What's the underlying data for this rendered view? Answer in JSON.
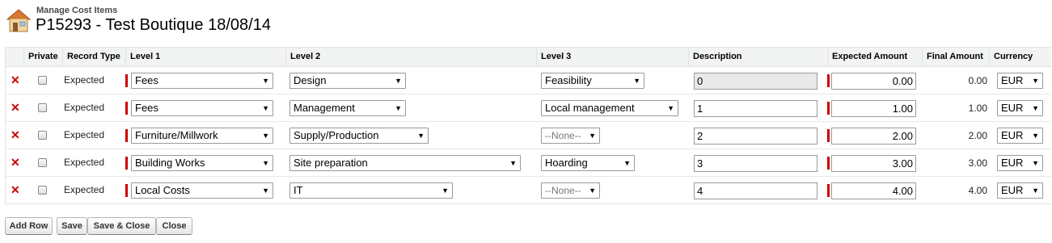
{
  "header": {
    "subtitle": "Manage Cost Items",
    "title": "P15293 - Test Boutique 18/08/14",
    "icon": "home-icon"
  },
  "columns": {
    "private": "Private",
    "record_type": "Record Type",
    "level1": "Level 1",
    "level2": "Level 2",
    "level3": "Level 3",
    "description": "Description",
    "expected_amount": "Expected Amount",
    "final_amount": "Final Amount",
    "currency": "Currency"
  },
  "rows": [
    {
      "record_type": "Expected",
      "level1": "Fees",
      "level2": "Design",
      "level3": "Feasibility",
      "description": "0",
      "expected": "0.00",
      "final": "0.00",
      "currency": "EUR"
    },
    {
      "record_type": "Expected",
      "level1": "Fees",
      "level2": "Management",
      "level3": "Local management",
      "description": "1",
      "expected": "1.00",
      "final": "1.00",
      "currency": "EUR"
    },
    {
      "record_type": "Expected",
      "level1": "Furniture/Millwork",
      "level2": "Supply/Production",
      "level3": "--None--",
      "description": "2",
      "expected": "2.00",
      "final": "2.00",
      "currency": "EUR"
    },
    {
      "record_type": "Expected",
      "level1": "Building Works",
      "level2": "Site preparation",
      "level3": "Hoarding",
      "description": "3",
      "expected": "3.00",
      "final": "3.00",
      "currency": "EUR"
    },
    {
      "record_type": "Expected",
      "level1": "Local Costs",
      "level2": "IT",
      "level3": "--None--",
      "description": "4",
      "expected": "4.00",
      "final": "4.00",
      "currency": "EUR"
    }
  ],
  "buttons": {
    "add_row": "Add Row",
    "save": "Save",
    "save_close": "Save & Close",
    "close": "Close"
  },
  "colors": {
    "required": "#cc0000",
    "delete": "#cc0000",
    "header_bg": "#f2f3f3"
  }
}
